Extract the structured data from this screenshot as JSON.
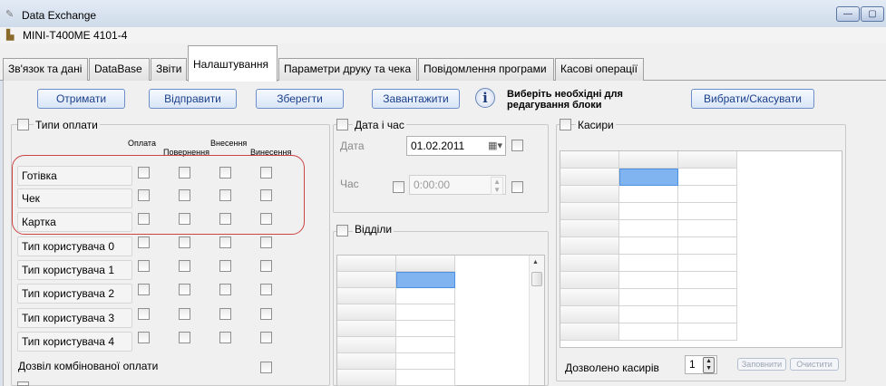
{
  "window": {
    "title": "Data Exchange",
    "device": "MINI-T400ME  4101-4",
    "minimize_glyph": "—",
    "maximize_glyph": "▢"
  },
  "tabs": [
    "Зв'язок та дані",
    "DataBase",
    "Звіти",
    "Налаштування",
    "Параметри друку та чека",
    "Повідомлення програми",
    "Касові операції"
  ],
  "toolbar": {
    "get_label": "Отримати",
    "send_label": "Відправити",
    "save_label": "Зберегти",
    "load_label": "Завантажити",
    "info_text_line1": "Виберіть необхідні для",
    "info_text_line2": "редагування блоки",
    "select_label": "Вибрати/Скасувати"
  },
  "payment_types": {
    "title": "Типи оплати",
    "columns": [
      "Оплата",
      "Повернення",
      "Внесення",
      "Винесення"
    ],
    "rows": [
      "Готівка",
      "Чек",
      "Картка",
      "Тип користувача 0",
      "Тип користувача 1",
      "Тип користувача 2",
      "Тип користувача 3",
      "Тип користувача 4"
    ],
    "combined_label": "Дозвіл комбінованої оплати"
  },
  "datetime": {
    "title": "Дата і час",
    "date_label": "Дата",
    "date_value": "01.02.2011",
    "time_label": "Час",
    "time_value": "0:00:00"
  },
  "departments": {
    "title": "Відділи"
  },
  "cashiers": {
    "title": "Касири",
    "allowed_label": "Дозволено  касирів",
    "allowed_value": "1",
    "fill_label": "Заповнити",
    "clear_label": "Очистити"
  }
}
